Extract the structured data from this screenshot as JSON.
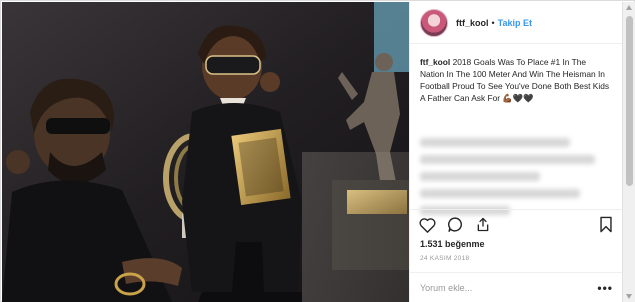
{
  "post": {
    "username": "ftf_kool",
    "separator": "•",
    "follow_label": "Takip Et",
    "caption_user": "ftf_kool",
    "caption_text": " 2018 Goals Was To Place #1 In The Nation In The 100 Meter And Win The Heisman In Football Proud To See You've Done Both Best Kids A Father Can Ask For 💪🏾🖤🖤",
    "likes": "1.531 beğenme",
    "date": "24 KASIM 2018",
    "comment_placeholder": "Yorum ekle...",
    "more_label": "•••"
  },
  "icons": {
    "like": "heart-icon",
    "comment": "comment-icon",
    "share": "share-icon",
    "save": "bookmark-icon",
    "more": "more-options-icon"
  },
  "colors": {
    "link_blue": "#3897f0",
    "text": "#262626",
    "muted": "#999999",
    "border": "#efefef"
  }
}
